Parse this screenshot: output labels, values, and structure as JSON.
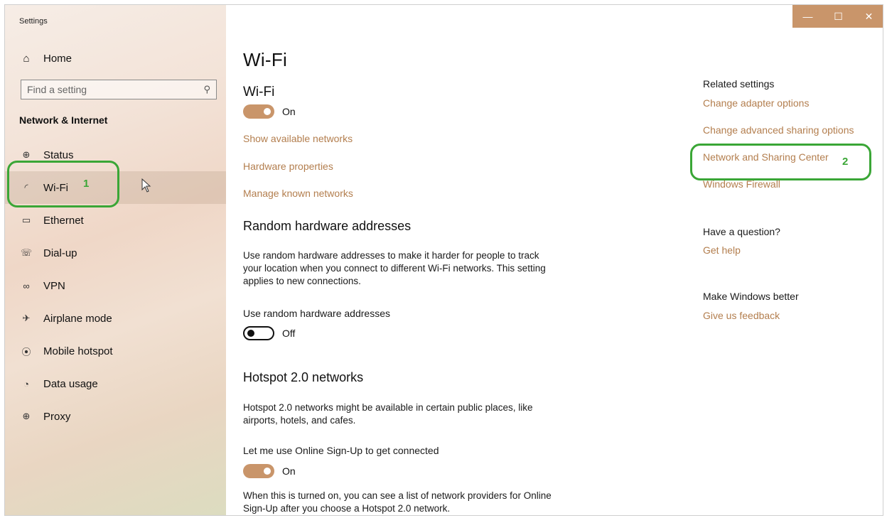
{
  "app": {
    "title": "Settings"
  },
  "window_controls": {
    "minimize": "—",
    "maximize": "☐",
    "close": "✕"
  },
  "sidebar": {
    "home": "Home",
    "search_placeholder": "Find a setting",
    "section": "Network & Internet",
    "items": [
      {
        "label": "Status",
        "icon": "globe-icon"
      },
      {
        "label": "Wi-Fi",
        "icon": "wifi-icon",
        "active": true
      },
      {
        "label": "Ethernet",
        "icon": "ethernet-icon"
      },
      {
        "label": "Dial-up",
        "icon": "dialup-icon"
      },
      {
        "label": "VPN",
        "icon": "vpn-icon"
      },
      {
        "label": "Airplane mode",
        "icon": "airplane-icon"
      },
      {
        "label": "Mobile hotspot",
        "icon": "hotspot-icon"
      },
      {
        "label": "Data usage",
        "icon": "data-usage-icon"
      },
      {
        "label": "Proxy",
        "icon": "proxy-icon"
      }
    ]
  },
  "annotations": {
    "one": "1",
    "two": "2",
    "color": "#3aa636"
  },
  "main": {
    "title": "Wi-Fi",
    "wifi_heading": "Wi-Fi",
    "wifi_toggle": "On",
    "links": [
      "Show available networks",
      "Hardware properties",
      "Manage known networks"
    ],
    "random_heading": "Random hardware addresses",
    "random_desc": "Use random hardware addresses to make it harder for people to track your location when you connect to different Wi-Fi networks. This setting applies to new connections.",
    "random_label": "Use random hardware addresses",
    "random_toggle": "Off",
    "hotspot_heading": "Hotspot 2.0 networks",
    "hotspot_desc": "Hotspot 2.0 networks might be available in certain public places, like airports, hotels, and cafes.",
    "signup_label": "Let me use Online Sign-Up to get connected",
    "signup_toggle": "On",
    "signup_desc": "When this is turned on, you can see a list of network providers for Online Sign-Up after you choose a Hotspot 2.0 network."
  },
  "related": {
    "heading": "Related settings",
    "links": [
      "Change adapter options",
      "Change advanced sharing options",
      "Network and Sharing Center",
      "Windows Firewall"
    ],
    "question_heading": "Have a question?",
    "help": "Get help",
    "better_heading": "Make Windows better",
    "feedback": "Give us feedback"
  },
  "colors": {
    "accent": "#c9956a",
    "link": "#b37e4e"
  }
}
